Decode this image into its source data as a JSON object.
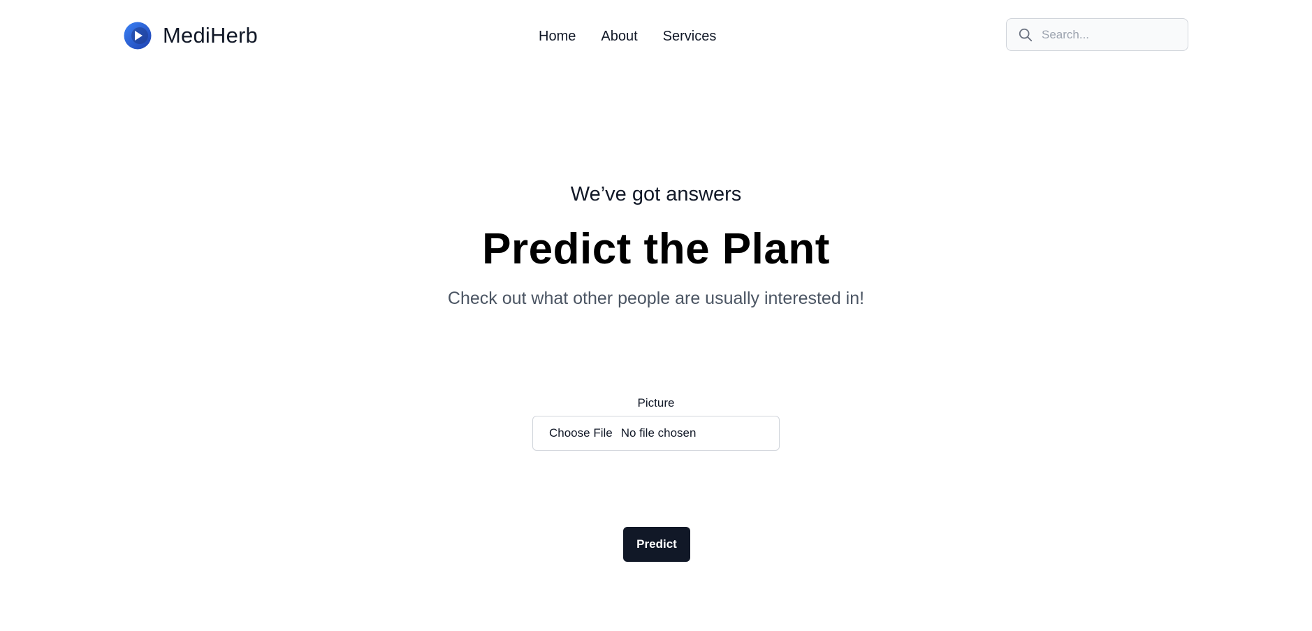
{
  "header": {
    "brand_name": "MediHerb",
    "logo_icon": "play-circle-logo-icon",
    "nav": [
      {
        "label": "Home"
      },
      {
        "label": "About"
      },
      {
        "label": "Services"
      }
    ],
    "search": {
      "placeholder": "Search...",
      "value": "",
      "icon": "search-icon"
    }
  },
  "hero": {
    "eyebrow": "We’ve got answers",
    "title": "Predict the Plant",
    "subtitle": "Check out what other people are usually interested in!"
  },
  "form": {
    "picture_label": "Picture",
    "file_button_label": "Choose File",
    "file_status": "No file chosen",
    "submit_label": "Predict"
  },
  "colors": {
    "brand_blue": "#1d4ed8",
    "primary_button": "#111827",
    "subtitle_text": "#4b5563",
    "border": "#d1d5db"
  }
}
